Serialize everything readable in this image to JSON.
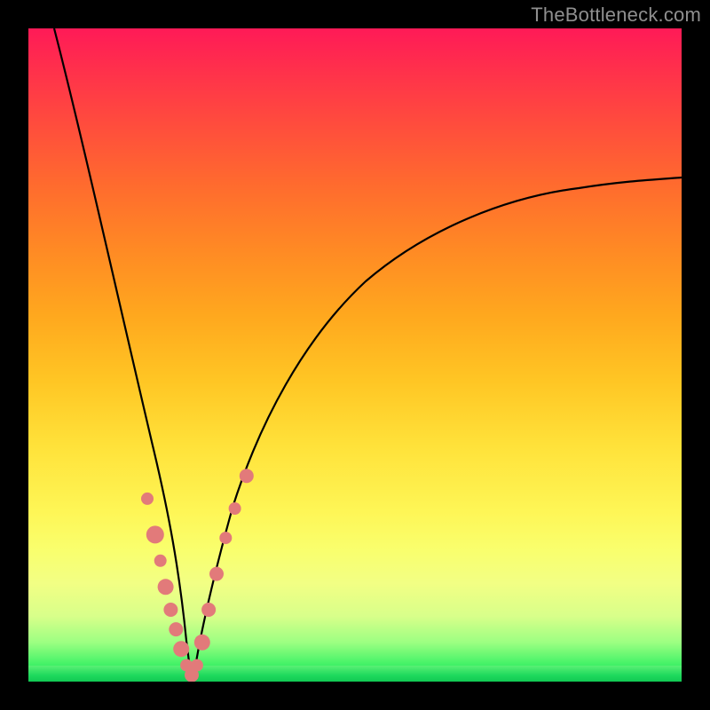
{
  "watermark": "TheBottleneck.com",
  "chart_data": {
    "type": "line",
    "title": "",
    "xlabel": "",
    "ylabel": "",
    "xlim": [
      0,
      100
    ],
    "ylim": [
      0,
      100
    ],
    "grid": false,
    "series": [
      {
        "name": "left-branch",
        "x": [
          4,
          6,
          8,
          10,
          12,
          14,
          16,
          17,
          18,
          19,
          20,
          21,
          22,
          23,
          24,
          24.6
        ],
        "values": [
          100,
          88,
          76,
          65,
          55,
          45,
          36,
          31,
          27,
          23,
          19,
          15,
          11,
          8,
          4,
          1
        ]
      },
      {
        "name": "right-branch",
        "x": [
          25.4,
          26,
          27,
          28,
          30,
          32,
          35,
          40,
          45,
          50,
          55,
          60,
          65,
          70,
          75,
          80,
          85,
          90,
          95,
          100
        ],
        "values": [
          1,
          4,
          9,
          14,
          22,
          28,
          35,
          44,
          50,
          55,
          59,
          62.5,
          65.5,
          68,
          70,
          72,
          73.5,
          75,
          76,
          77
        ]
      }
    ],
    "highlight_points": {
      "name": "region-markers",
      "color": "#e27a7a",
      "points": [
        {
          "x": 18.2,
          "y": 28.0,
          "r": 7
        },
        {
          "x": 19.4,
          "y": 22.5,
          "r": 10
        },
        {
          "x": 20.2,
          "y": 18.5,
          "r": 7
        },
        {
          "x": 21.0,
          "y": 14.5,
          "r": 9
        },
        {
          "x": 21.8,
          "y": 11.0,
          "r": 8
        },
        {
          "x": 22.6,
          "y": 8.0,
          "r": 8
        },
        {
          "x": 23.4,
          "y": 5.0,
          "r": 9
        },
        {
          "x": 24.2,
          "y": 2.5,
          "r": 7
        },
        {
          "x": 25.0,
          "y": 1.0,
          "r": 8
        },
        {
          "x": 25.8,
          "y": 2.5,
          "r": 7
        },
        {
          "x": 26.6,
          "y": 6.0,
          "r": 9
        },
        {
          "x": 27.6,
          "y": 11.0,
          "r": 8
        },
        {
          "x": 28.8,
          "y": 16.5,
          "r": 8
        },
        {
          "x": 30.2,
          "y": 22.0,
          "r": 7
        },
        {
          "x": 31.6,
          "y": 26.5,
          "r": 7
        },
        {
          "x": 33.4,
          "y": 31.5,
          "r": 8
        }
      ]
    },
    "background_gradient": {
      "stops": [
        {
          "pos": 0.0,
          "color": "#ff1a57"
        },
        {
          "pos": 0.5,
          "color": "#ffc624"
        },
        {
          "pos": 0.8,
          "color": "#f9ff6e"
        },
        {
          "pos": 0.97,
          "color": "#4cf46a"
        },
        {
          "pos": 1.0,
          "color": "#13d857"
        }
      ]
    }
  }
}
